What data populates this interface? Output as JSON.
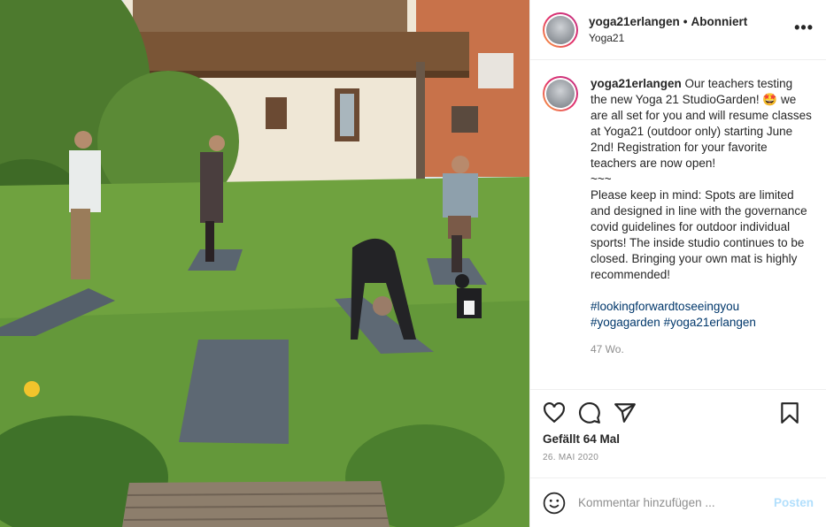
{
  "header": {
    "username": "yoga21erlangen",
    "separator": "•",
    "follow_status": "Abonniert",
    "location": "Yoga21",
    "more_label": "•••"
  },
  "caption": {
    "username": "yoga21erlangen",
    "text": " Our teachers testing the new Yoga 21 StudioGarden! 🤩 we are all set for you and will resume classes at Yoga21 (outdoor only) starting June 2nd! Registration for your favorite teachers are now open!\n~~~\nPlease keep in mind: Spots are limited and designed in line with the governance covid guidelines for outdoor individual sports! The inside studio continues to be closed. Bringing your own mat is highly recommended!\n\n",
    "hashtags": "#lookingforwardtoseeingyou #yogagarden #yoga21erlangen",
    "age": "47 Wo."
  },
  "actions": {
    "icons": [
      "heart-icon",
      "comment-icon",
      "share-icon",
      "bookmark-icon"
    ],
    "likes": "Gefällt 64 Mal",
    "date": "26. Mai 2020"
  },
  "comment_box": {
    "placeholder": "Kommentar hinzufügen ...",
    "post_label": "Posten"
  },
  "colors": {
    "link": "#00376b",
    "muted": "#8e8e8e",
    "post_disabled": "#b2dffc",
    "story_ring": [
      "#f9a33b",
      "#e1306c",
      "#c13584"
    ]
  }
}
